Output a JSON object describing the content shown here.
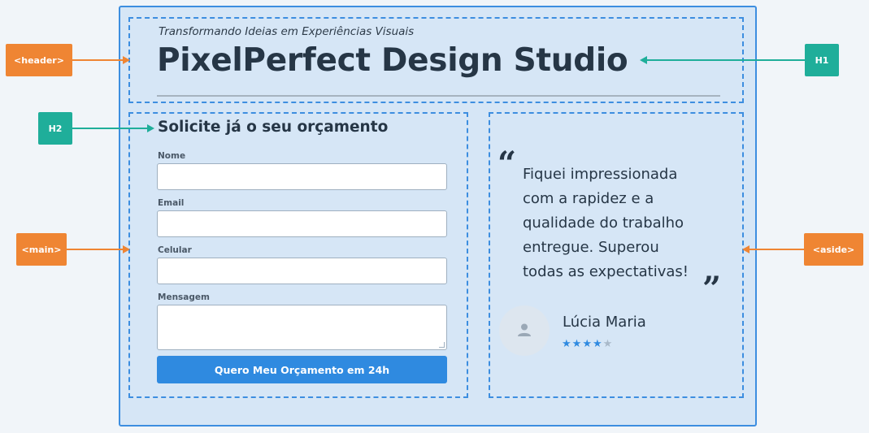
{
  "header": {
    "tagline": "Transformando Ideias em Experiências Visuais",
    "title": "PixelPerfect Design Studio"
  },
  "form": {
    "heading": "Solicite já o seu orçamento",
    "fields": [
      {
        "label": "Nome",
        "value": ""
      },
      {
        "label": "Email",
        "value": ""
      },
      {
        "label": "Celular",
        "value": ""
      },
      {
        "label": "Mensagem",
        "value": ""
      }
    ],
    "submit_label": "Quero Meu Orçamento em 24h"
  },
  "testimonial": {
    "open_quote": "“",
    "close_quote": "”",
    "quote_lines": [
      "Fiquei impressionada",
      "com a rapidez e a",
      "qualidade do trabalho",
      "entregue. Superou",
      "todas as expectativas!"
    ],
    "author": "Lúcia Maria",
    "rating": 4,
    "rating_max": 5,
    "avatar_icon": "user-icon"
  },
  "annotations": {
    "header_tag": "<header>",
    "main_tag": "<main>",
    "aside_tag": "<aside>",
    "h1_tag": "H1",
    "h2_tag": "H2"
  },
  "colors": {
    "semantic_tag": "#ef8533",
    "heading_tag": "#1fae9a",
    "accent": "#2f8ae0",
    "region_border": "#3d8ee0"
  }
}
